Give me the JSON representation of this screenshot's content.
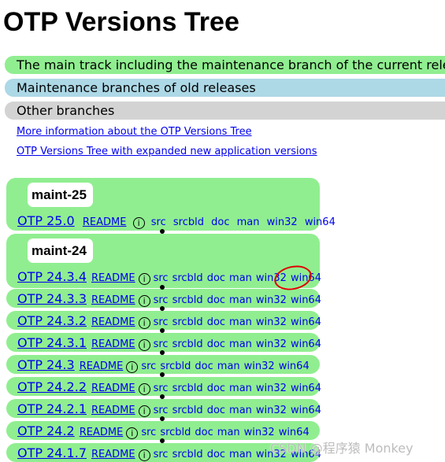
{
  "page": {
    "title": "OTP Versions Tree"
  },
  "legend": {
    "green": "The main track including the maintenance branch of the current release",
    "blue": "Maintenance branches of old releases",
    "grey": "Other branches",
    "colors": {
      "green": "#90ee90",
      "blue": "#add8e6",
      "grey": "#d3d3d3"
    }
  },
  "links": {
    "more_info": "More information about the OTP Versions Tree",
    "expanded": "OTP Versions Tree with expanded new application versions"
  },
  "branches": [
    {
      "name": "maint-25",
      "releases": [
        {
          "version": "OTP 25.0",
          "readme": "README",
          "info_icon": "info-icon",
          "links": [
            "src",
            "srcbld",
            "doc",
            "man",
            "win32",
            "win64"
          ]
        }
      ]
    },
    {
      "name": "maint-24",
      "releases": [
        {
          "version": "OTP 24.3.4",
          "readme": "README",
          "info_icon": "info-icon",
          "links": [
            "src",
            "srcbld",
            "doc",
            "man",
            "win32",
            "win64"
          ],
          "win64_circled": true
        },
        {
          "version": "OTP 24.3.3",
          "readme": "README",
          "info_icon": "info-icon",
          "links": [
            "src",
            "srcbld",
            "doc",
            "man",
            "win32",
            "win64"
          ]
        },
        {
          "version": "OTP 24.3.2",
          "readme": "README",
          "info_icon": "info-icon",
          "links": [
            "src",
            "srcbld",
            "doc",
            "man",
            "win32",
            "win64"
          ]
        },
        {
          "version": "OTP 24.3.1",
          "readme": "README",
          "info_icon": "info-icon",
          "links": [
            "src",
            "srcbld",
            "doc",
            "man",
            "win32",
            "win64"
          ]
        },
        {
          "version": "OTP 24.3",
          "readme": "README",
          "info_icon": "info-icon",
          "links": [
            "src",
            "srcbld",
            "doc",
            "man",
            "win32",
            "win64"
          ]
        },
        {
          "version": "OTP 24.2.2",
          "readme": "README",
          "info_icon": "info-icon",
          "links": [
            "src",
            "srcbld",
            "doc",
            "man",
            "win32",
            "win64"
          ]
        },
        {
          "version": "OTP 24.2.1",
          "readme": "README",
          "info_icon": "info-icon",
          "links": [
            "src",
            "srcbld",
            "doc",
            "man",
            "win32",
            "win64"
          ]
        },
        {
          "version": "OTP 24.2",
          "readme": "README",
          "info_icon": "info-icon",
          "links": [
            "src",
            "srcbld",
            "doc",
            "man",
            "win32",
            "win64"
          ]
        },
        {
          "version": "OTP 24.1.7",
          "readme": "README",
          "info_icon": "info-icon",
          "links": [
            "src",
            "srcbld",
            "doc",
            "man",
            "win32",
            "win64"
          ]
        }
      ]
    }
  ],
  "watermark": "CSDN @程序猿 Monkey",
  "annotation_color": "#e00000"
}
